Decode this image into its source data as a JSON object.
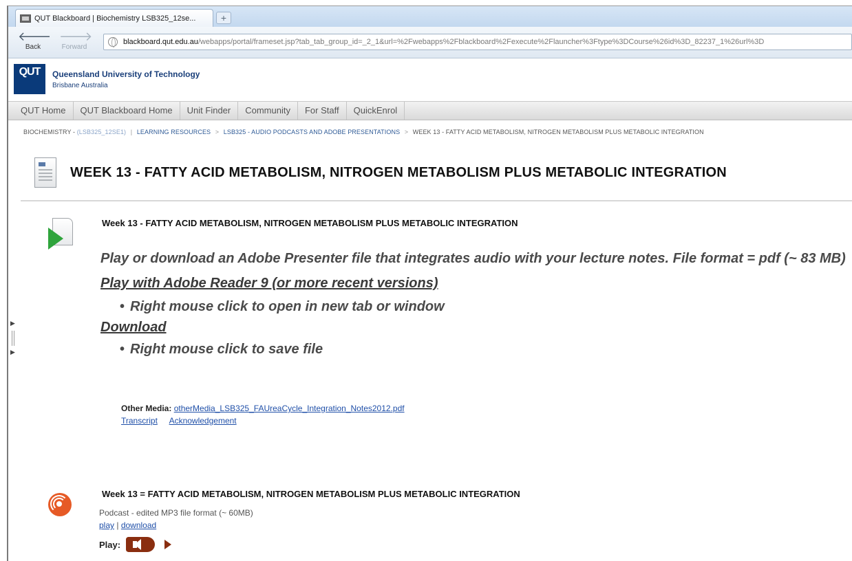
{
  "browser": {
    "tab_title": "QUT Blackboard | Biochemistry LSB325_12se...",
    "new_tab_glyph": "+",
    "back_label": "Back",
    "forward_label": "Forward",
    "url_host": "blackboard.qut.edu.au",
    "url_path": "/webapps/portal/frameset.jsp?tab_tab_group_id=_2_1&url=%2Fwebapps%2Fblackboard%2Fexecute%2Flauncher%3Ftype%3DCourse%26id%3D_82237_1%26url%3D"
  },
  "header": {
    "logo_text": "QUT",
    "university_name": "Queensland University of Technology",
    "location": "Brisbane Australia"
  },
  "top_nav": [
    "QUT Home",
    "QUT Blackboard Home",
    "Unit Finder",
    "Community",
    "For Staff",
    "QuickEnrol"
  ],
  "breadcrumb": {
    "course": "BIOCHEMISTRY -",
    "course_id": "(LSB325_12SE1)",
    "items": [
      "LEARNING RESOURCES",
      "LSB325 - AUDIO PODCASTS AND ADOBE PRESENTATIONS",
      "WEEK 13 - FATTY ACID METABOLISM, NITROGEN METABOLISM PLUS METABOLIC INTEGRATION"
    ]
  },
  "page_title": "WEEK 13 - FATTY ACID METABOLISM, NITROGEN METABOLISM PLUS METABOLIC INTEGRATION",
  "item1": {
    "title": "Week 13 - FATTY ACID METABOLISM, NITROGEN METABOLISM PLUS METABOLIC INTEGRATION",
    "description": "Play or download an Adobe Presenter file that integrates audio with your lecture notes. File format = pdf (~ 83 MB)",
    "play_link": "Play with Adobe Reader 9 (or more recent versions)",
    "play_hint": "Right mouse click to open in new tab or window",
    "download_link": "Download",
    "download_hint": "Right mouse click to save file",
    "other_media_label": "Other Media:",
    "other_media_file": "otherMedia_LSB325_FAUreaCycle_Integration_Notes2012.pdf",
    "transcript_link": "Transcript",
    "acknowledgement_link": "Acknowledgement"
  },
  "item2": {
    "title": "Week 13 = FATTY ACID METABOLISM, NITROGEN METABOLISM PLUS METABOLIC INTEGRATION",
    "meta": "Podcast - edited MP3 file format (~ 60MB)",
    "play_link": "play",
    "separator": "|",
    "download_link": "download",
    "play_label": "Play:"
  },
  "icons": {
    "doc_play": "document-play-icon",
    "podcast": "podcast-icon",
    "speaker": "speaker-icon",
    "play": "play-icon",
    "brand_color": "#0a3a7a",
    "podcast_color": "#e65a26",
    "link_color": "#1f4fa8"
  }
}
